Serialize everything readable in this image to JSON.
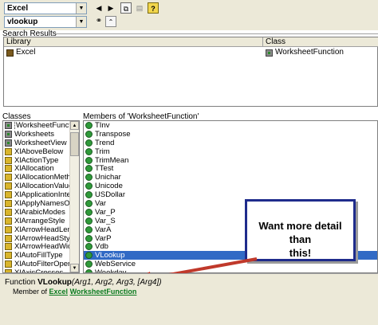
{
  "toolbar": {
    "library_combo": "Excel",
    "search_combo": "vlookup"
  },
  "search_results": {
    "label": "Search Results",
    "col_library": "Library",
    "col_class": "Class",
    "row_library": "Excel",
    "row_class": "WorksheetFunction"
  },
  "classes": {
    "label": "Classes",
    "items": [
      {
        "label": "WorksheetFunction",
        "icon": "class"
      },
      {
        "label": "Worksheets",
        "icon": "class"
      },
      {
        "label": "WorksheetView",
        "icon": "class"
      },
      {
        "label": "XlAboveBelow",
        "icon": "enum"
      },
      {
        "label": "XlActionType",
        "icon": "enum"
      },
      {
        "label": "XlAllocation",
        "icon": "enum"
      },
      {
        "label": "XlAllocationMethod",
        "icon": "enum"
      },
      {
        "label": "XlAllocationValue",
        "icon": "enum"
      },
      {
        "label": "XlApplicationInternat",
        "icon": "enum"
      },
      {
        "label": "XlApplyNamesOrder",
        "icon": "enum"
      },
      {
        "label": "XlArabicModes",
        "icon": "enum"
      },
      {
        "label": "XlArrangeStyle",
        "icon": "enum"
      },
      {
        "label": "XlArrowHeadLength",
        "icon": "enum"
      },
      {
        "label": "XlArrowHeadStyle",
        "icon": "enum"
      },
      {
        "label": "XlArrowHeadWidth",
        "icon": "enum"
      },
      {
        "label": "XlAutoFillType",
        "icon": "enum"
      },
      {
        "label": "XlAutoFilterOperator",
        "icon": "enum"
      },
      {
        "label": "XlAxisCrosses",
        "icon": "enum"
      }
    ]
  },
  "members": {
    "label": "Members of 'WorksheetFunction'",
    "items": [
      "TInv",
      "Transpose",
      "Trend",
      "Trim",
      "TrimMean",
      "TTest",
      "Unichar",
      "Unicode",
      "USDollar",
      "Var",
      "Var_P",
      "Var_S",
      "VarA",
      "VarP",
      "Vdb",
      "VLookup",
      "WebService",
      "Weekday",
      "WeekNum"
    ],
    "selected_index": 15
  },
  "callout": {
    "line1": "Want more detail than",
    "line2": "this!"
  },
  "details": {
    "prefix": "Function ",
    "name": "VLookup",
    "args": "(Arg1, Arg2, Arg3, [Arg4])",
    "member_of_label": "Member of ",
    "member_of_library": "Excel",
    "member_of_class": "WorksheetFunction"
  },
  "colors": {
    "selection": "#316ac5",
    "callout_border": "#1f2c8c",
    "arrow": "#c0392b",
    "link": "#0a7a1e"
  }
}
